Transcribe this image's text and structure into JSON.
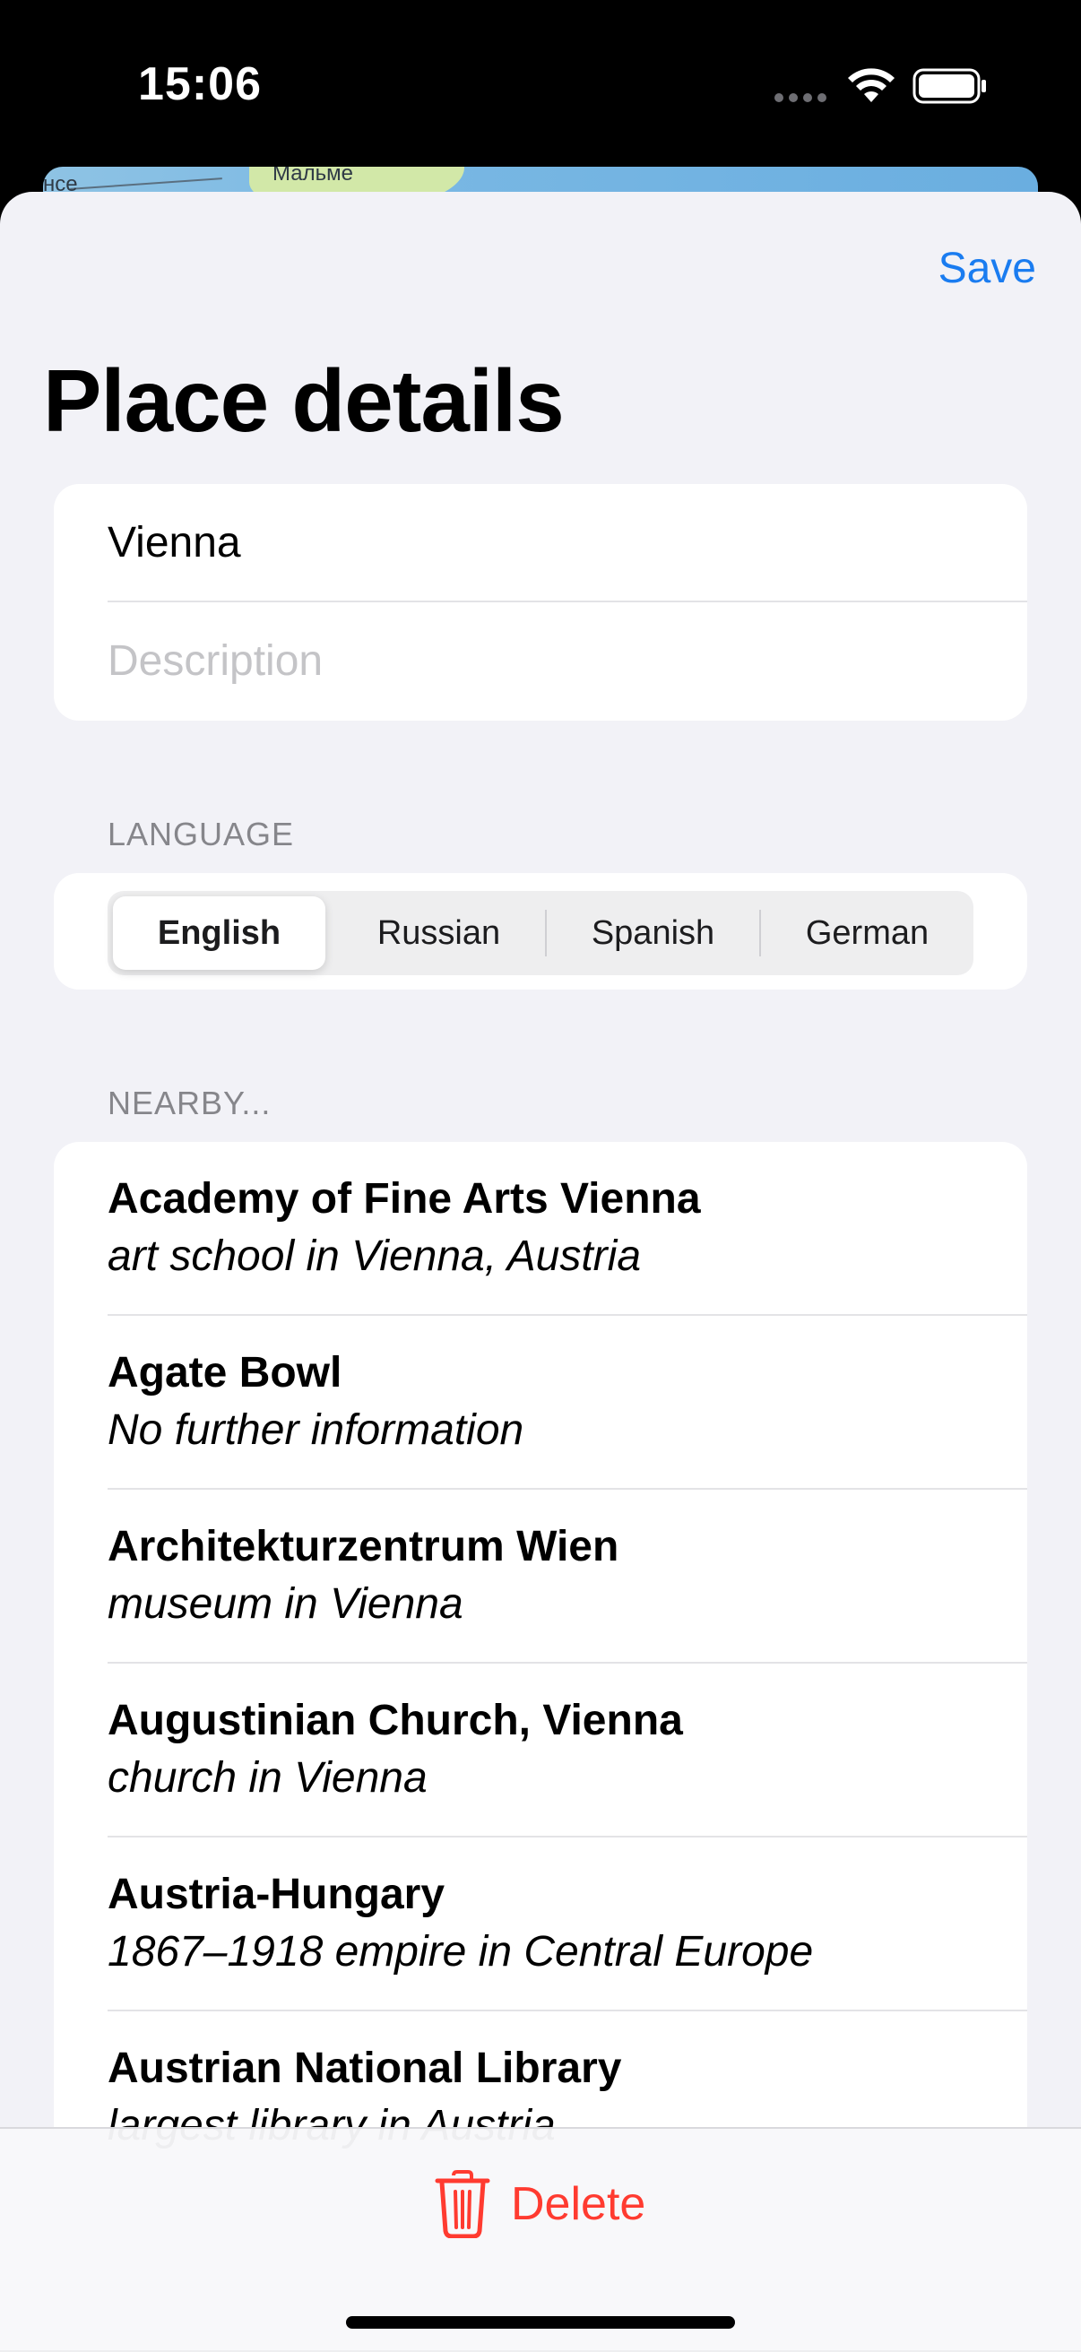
{
  "status_bar": {
    "time": "15:06"
  },
  "map_peek": {
    "label_left": "нсе",
    "label_right": "Мальме"
  },
  "header": {
    "save_label": "Save",
    "title": "Place details"
  },
  "fields": {
    "name_value": "Vienna",
    "description_placeholder": "Description"
  },
  "language": {
    "section_title": "LANGUAGE",
    "options": [
      "English",
      "Russian",
      "Spanish",
      "German"
    ],
    "selected": "English"
  },
  "nearby": {
    "section_title": "NEARBY...",
    "items": [
      {
        "title": "Academy of Fine Arts Vienna",
        "subtitle": "art school in Vienna, Austria"
      },
      {
        "title": "Agate Bowl",
        "subtitle": "No further information"
      },
      {
        "title": "Architekturzentrum Wien",
        "subtitle": "museum in Vienna"
      },
      {
        "title": "Augustinian Church, Vienna",
        "subtitle": "church in Vienna"
      },
      {
        "title": "Austria-Hungary",
        "subtitle": "1867–1918 empire in Central Europe"
      },
      {
        "title": "Austrian National Library",
        "subtitle": "largest library in Austria"
      }
    ]
  },
  "toolbar": {
    "delete_label": "Delete"
  },
  "colors": {
    "accent": "#1a7cf0",
    "destructive": "#ff3b30",
    "background": "#f2f2f7"
  }
}
